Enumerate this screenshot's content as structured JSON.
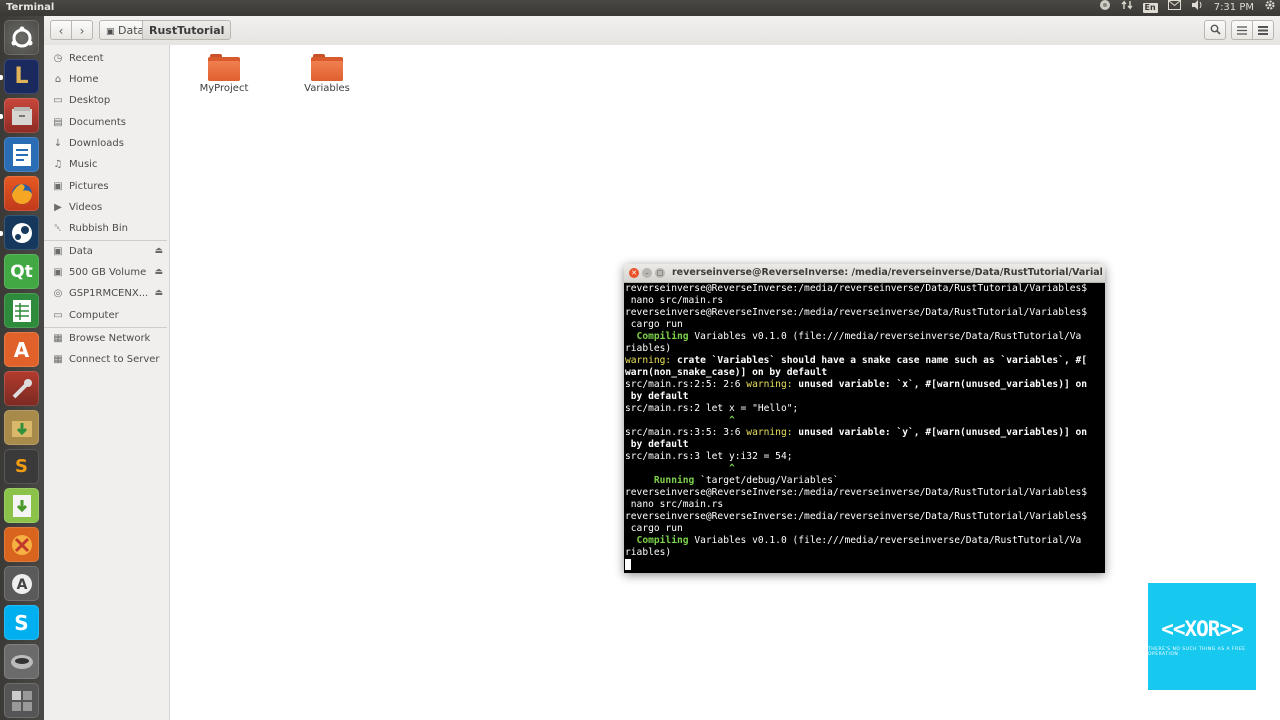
{
  "topbar": {
    "window_title": "Terminal",
    "keyboard_layout": "En",
    "clock": "7:31 PM"
  },
  "launcher": {
    "items": [
      "Ubuntu dash",
      "LibreOffice Impress",
      "Files",
      "LibreOffice Writer",
      "Firefox",
      "Steam",
      "Qt Creator",
      "LibreOffice Calc",
      "Ubuntu Software Center",
      "System Settings",
      "Archive Manager",
      "Sublime Text",
      "Software Updater",
      "CodeBlocks",
      "Update",
      "Skype",
      "Disk Utility",
      "Workspaces"
    ]
  },
  "file_manager": {
    "breadcrumb": [
      "Data",
      "RustTutorial"
    ],
    "sidebar": {
      "places": [
        {
          "label": "Recent",
          "icon": "clock-icon"
        },
        {
          "label": "Home",
          "icon": "home-icon"
        },
        {
          "label": "Desktop",
          "icon": "desktop-icon"
        },
        {
          "label": "Documents",
          "icon": "document-icon"
        },
        {
          "label": "Downloads",
          "icon": "download-icon"
        },
        {
          "label": "Music",
          "icon": "music-icon"
        },
        {
          "label": "Pictures",
          "icon": "camera-icon"
        },
        {
          "label": "Videos",
          "icon": "video-icon"
        },
        {
          "label": "Rubbish Bin",
          "icon": "trash-icon"
        }
      ],
      "devices": [
        {
          "label": "Data",
          "icon": "drive-icon"
        },
        {
          "label": "500 GB Volume",
          "icon": "drive-icon"
        },
        {
          "label": "GSP1RMCENX...",
          "icon": "disc-icon"
        },
        {
          "label": "Computer",
          "icon": "computer-icon"
        }
      ],
      "network": [
        {
          "label": "Browse Network",
          "icon": "network-icon"
        },
        {
          "label": "Connect to Server",
          "icon": "server-icon"
        }
      ]
    },
    "folders": [
      "MyProject",
      "Variables"
    ]
  },
  "terminal": {
    "title": "reverseinverse@ReverseInverse: /media/reverseinverse/Data/RustTutorial/Variables",
    "prompt": "reverseinverse@ReverseInverse:/media/reverseinverse/Data/RustTutorial/Variables$",
    "cmd_nano": " nano src/main.rs",
    "cmd_cargo": " cargo run",
    "compiling_label": "  Compiling",
    "compiling_text1": " Variables v0.1.0 (file:///media/reverseinverse/Data/RustTutorial/Va",
    "compiling_text2": "riables)",
    "warning_label": "warning:",
    "warning1_text1": " crate `Variables` should have a snake case name such as `variables`, #[",
    "warning1_text2": "warn(non_snake_case)] on by default",
    "w2_loc": "src/main.rs:2:5: 2:6 ",
    "w2_text1": " unused variable: `x`, #[warn(unused_variables)] on",
    "w2_text2": " by default",
    "w2_src": "src/main.rs:2 let x = \"Hello\";",
    "w2_caret": "                  ^",
    "w3_loc": "src/main.rs:3:5: 3:6 ",
    "w3_text1": " unused variable: `y`, #[warn(unused_variables)] on",
    "w3_text2": " by default",
    "w3_src": "src/main.rs:3 let y:i32 = 54;",
    "w3_caret": "                  ^",
    "running_label": "     Running",
    "running_text": " `target/debug/Variables`"
  },
  "logo": {
    "text": "<<XOR>>",
    "tagline": "THERE'S NO SUCH THING AS A FREE OPERATION"
  }
}
